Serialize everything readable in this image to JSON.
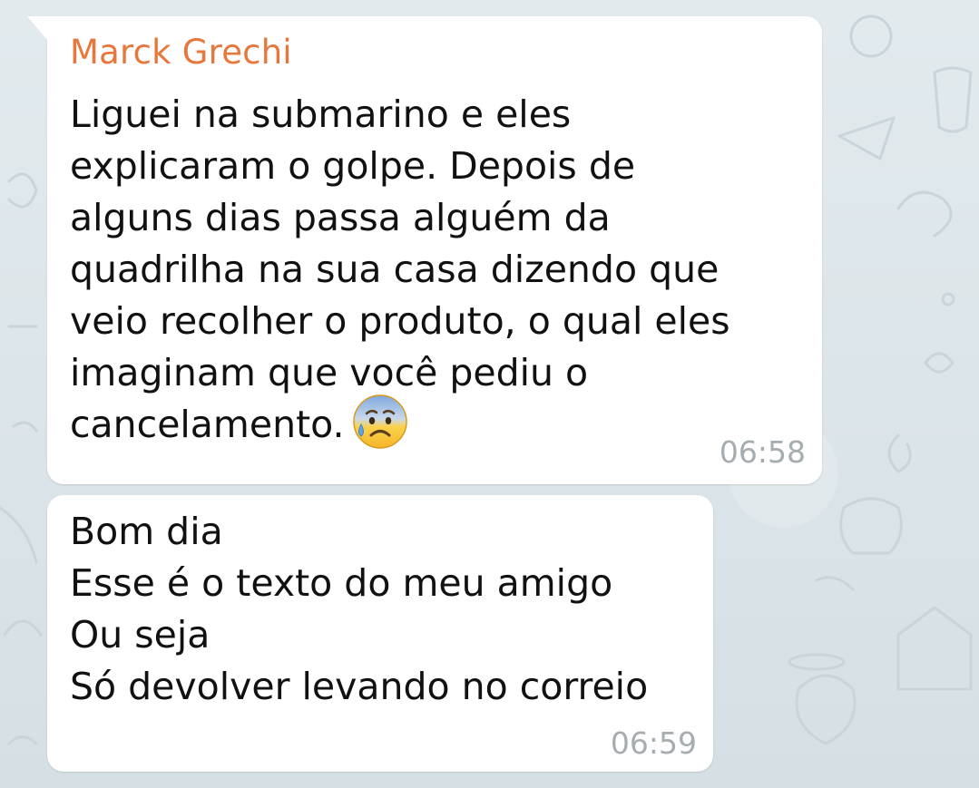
{
  "messages": [
    {
      "sender": "Marck Grechi",
      "text": "Liguei na submarino e eles\nexplicaram o golpe. Depois de\nalguns dias passa alguém da\nquadrilha na sua casa dizendo que\nveio recolher o produto, o qual eles\nimaginam que você pediu o\ncancelamento.",
      "emoji": "anxious-face-with-sweat-icon",
      "time": "06:58"
    },
    {
      "sender": "",
      "text": "Bom dia\nEsse é o texto do meu amigo\nOu seja\nSó devolver levando no correio",
      "time": "06:59"
    }
  ],
  "colors": {
    "sender_name": "#e8773c",
    "bubble": "#ffffff",
    "timestamp": "#a6adb0",
    "background": "#dde6ea"
  }
}
